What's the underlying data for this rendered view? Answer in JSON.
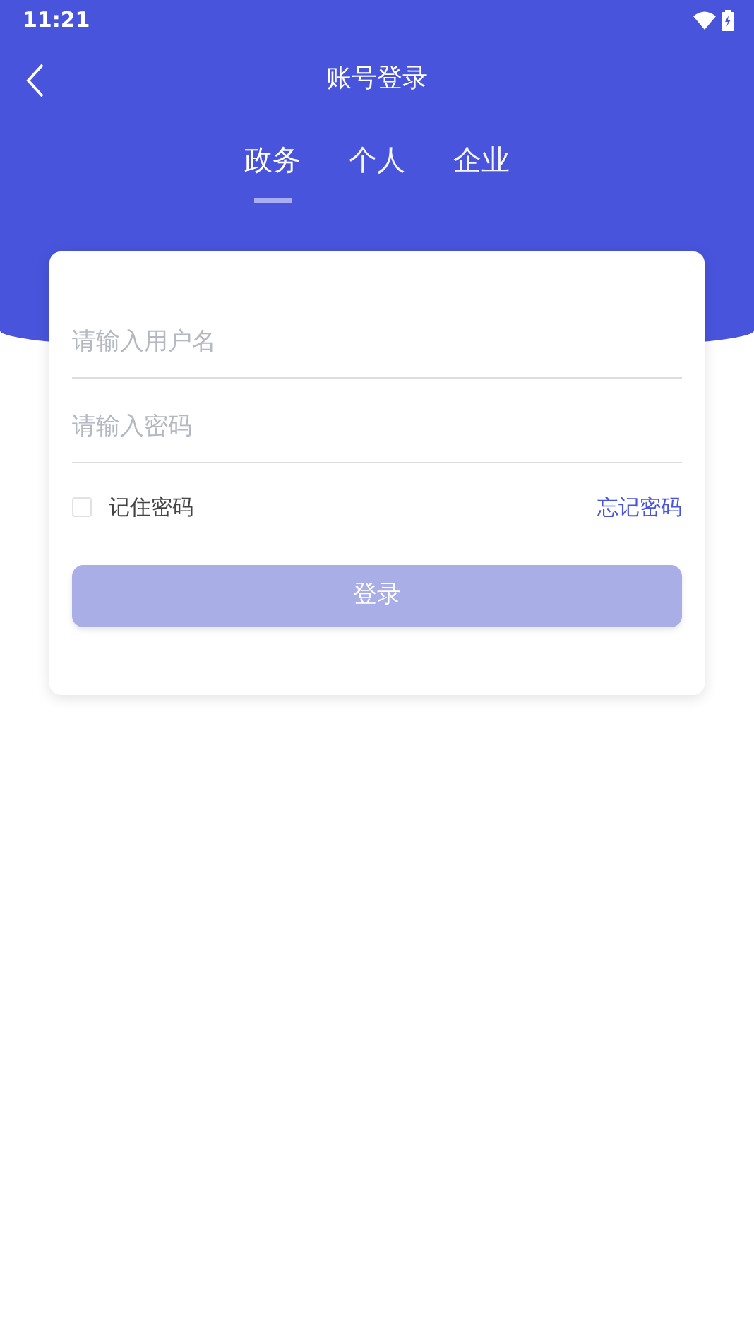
{
  "status_bar": {
    "time": "11:21"
  },
  "header": {
    "title": "账号登录"
  },
  "tabs": [
    {
      "label": "政务",
      "selected": true
    },
    {
      "label": "个人",
      "selected": false
    },
    {
      "label": "企业",
      "selected": false
    }
  ],
  "form": {
    "username": {
      "placeholder": "请输入用户名"
    },
    "password": {
      "placeholder": "请输入密码"
    },
    "remember": {
      "label": "记住密码",
      "checked": false
    },
    "forgot_link": "忘记密码",
    "login_button": {
      "label": "登录",
      "disabled": true
    }
  }
}
